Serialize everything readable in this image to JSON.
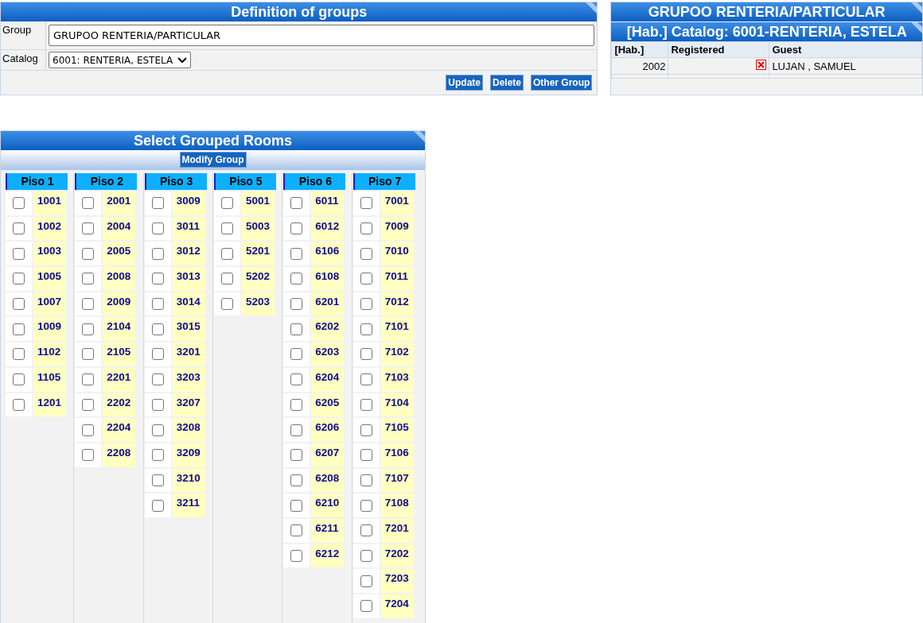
{
  "definition": {
    "title": "Definition of groups",
    "group_label": "Group",
    "group_value": "GRUPOO RENTERIA/PARTICULAR",
    "catalog_label": "Catalog",
    "catalog_value": "6001: RENTERIA, ESTELA",
    "buttons": [
      "Update",
      "Delete",
      "Other Group"
    ]
  },
  "catalog_panel": {
    "title": "GRUPOO RENTERIA/PARTICULAR",
    "subtitle": "[Hab.] Catalog: 6001-RENTERIA, ESTELA",
    "columns": [
      "[Hab.]",
      "Registered",
      "Guest"
    ],
    "rows": [
      {
        "hab": "2002",
        "registered": false,
        "guest": "LUJAN , SAMUEL"
      }
    ]
  },
  "rooms_panel": {
    "title": "Select Grouped Rooms",
    "button": "Modify Group",
    "floors": [
      {
        "name": "Piso 1",
        "rooms": [
          {
            "number": "1001",
            "checked": false
          },
          {
            "number": "1002",
            "checked": false
          },
          {
            "number": "1003",
            "checked": false
          },
          {
            "number": "1005",
            "checked": false
          },
          {
            "number": "1007",
            "checked": false
          },
          {
            "number": "1009",
            "checked": false
          },
          {
            "number": "1102",
            "checked": false
          },
          {
            "number": "1105",
            "checked": false
          },
          {
            "number": "1201",
            "checked": false
          }
        ]
      },
      {
        "name": "Piso 2",
        "rooms": [
          {
            "number": "2001",
            "checked": false
          },
          {
            "number": "2004",
            "checked": false
          },
          {
            "number": "2005",
            "checked": false
          },
          {
            "number": "2008",
            "checked": false
          },
          {
            "number": "2009",
            "checked": false
          },
          {
            "number": "2104",
            "checked": false
          },
          {
            "number": "2105",
            "checked": false
          },
          {
            "number": "2201",
            "checked": false
          },
          {
            "number": "2202",
            "checked": false
          },
          {
            "number": "2204",
            "checked": false
          },
          {
            "number": "2208",
            "checked": false
          }
        ]
      },
      {
        "name": "Piso 3",
        "rooms": [
          {
            "number": "3009",
            "checked": false
          },
          {
            "number": "3011",
            "checked": false
          },
          {
            "number": "3012",
            "checked": false
          },
          {
            "number": "3013",
            "checked": false
          },
          {
            "number": "3014",
            "checked": false
          },
          {
            "number": "3015",
            "checked": false
          },
          {
            "number": "3201",
            "checked": false
          },
          {
            "number": "3203",
            "checked": false
          },
          {
            "number": "3207",
            "checked": false
          },
          {
            "number": "3208",
            "checked": false
          },
          {
            "number": "3209",
            "checked": false
          },
          {
            "number": "3210",
            "checked": false
          },
          {
            "number": "3211",
            "checked": false
          }
        ]
      },
      {
        "name": "Piso 5",
        "rooms": [
          {
            "number": "5001",
            "checked": false
          },
          {
            "number": "5003",
            "checked": false
          },
          {
            "number": "5201",
            "checked": false
          },
          {
            "number": "5202",
            "checked": false
          },
          {
            "number": "5203",
            "checked": false
          }
        ]
      },
      {
        "name": "Piso 6",
        "rooms": [
          {
            "number": "6011",
            "checked": false
          },
          {
            "number": "6012",
            "checked": false
          },
          {
            "number": "6106",
            "checked": false
          },
          {
            "number": "6108",
            "checked": false
          },
          {
            "number": "6201",
            "checked": false
          },
          {
            "number": "6202",
            "checked": false
          },
          {
            "number": "6203",
            "checked": false
          },
          {
            "number": "6204",
            "checked": false
          },
          {
            "number": "6205",
            "checked": false
          },
          {
            "number": "6206",
            "checked": false
          },
          {
            "number": "6207",
            "checked": false
          },
          {
            "number": "6208",
            "checked": false
          },
          {
            "number": "6210",
            "checked": false
          },
          {
            "number": "6211",
            "checked": false
          },
          {
            "number": "6212",
            "checked": false
          }
        ]
      },
      {
        "name": "Piso 7",
        "rooms": [
          {
            "number": "7001",
            "checked": false
          },
          {
            "number": "7009",
            "checked": false
          },
          {
            "number": "7010",
            "checked": false
          },
          {
            "number": "7011",
            "checked": false
          },
          {
            "number": "7012",
            "checked": false
          },
          {
            "number": "7101",
            "checked": false
          },
          {
            "number": "7102",
            "checked": false
          },
          {
            "number": "7103",
            "checked": false
          },
          {
            "number": "7104",
            "checked": false
          },
          {
            "number": "7105",
            "checked": false
          },
          {
            "number": "7106",
            "checked": false
          },
          {
            "number": "7107",
            "checked": false
          },
          {
            "number": "7108",
            "checked": false
          },
          {
            "number": "7201",
            "checked": false
          },
          {
            "number": "7202",
            "checked": false
          },
          {
            "number": "7203",
            "checked": false
          },
          {
            "number": "7204",
            "checked": false
          }
        ]
      }
    ]
  }
}
